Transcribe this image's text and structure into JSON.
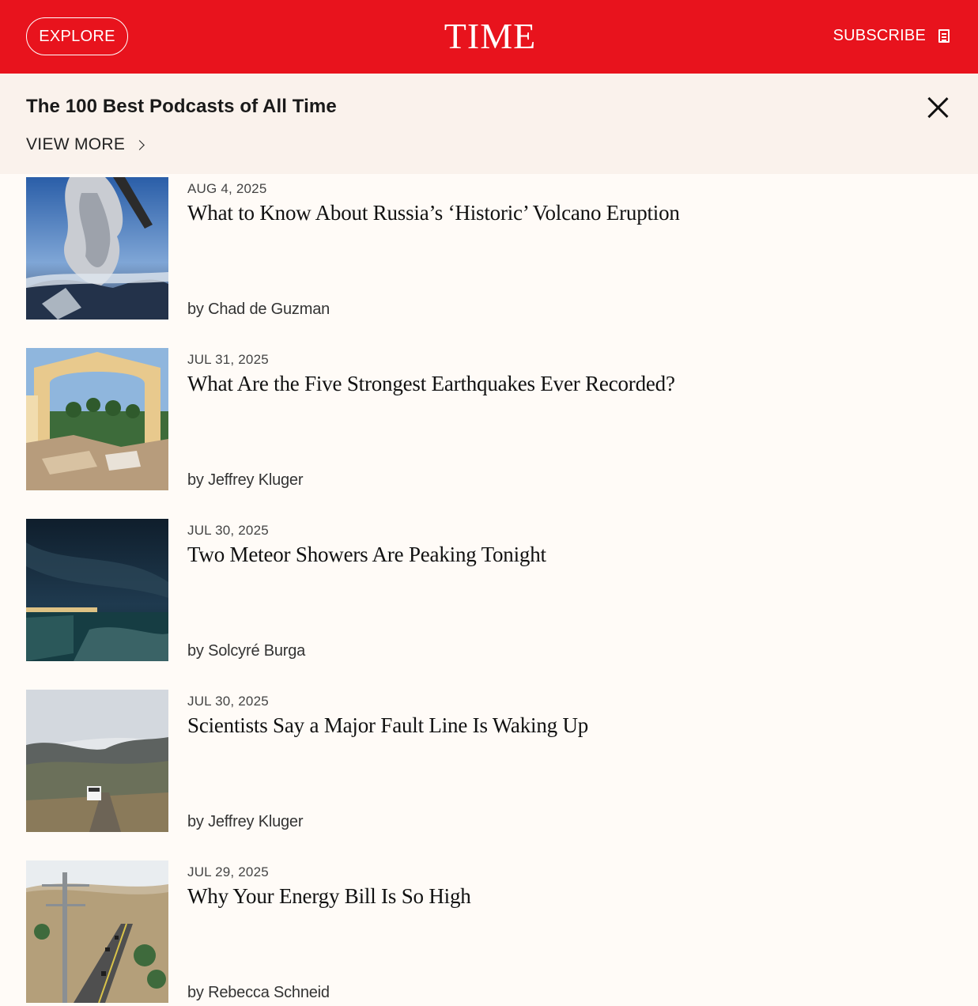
{
  "header": {
    "explore_label": "EXPLORE",
    "logo_text": "TIME",
    "subscribe_label": "SUBSCRIBE"
  },
  "banner": {
    "title": "The 100 Best Podcasts of All Time",
    "view_more_label": "VIEW MORE"
  },
  "articles": [
    {
      "date": "AUG 4, 2025",
      "title": "What to Know About Russia’s ‘Historic’ Volcano Eruption",
      "byline": "by Chad de Guzman"
    },
    {
      "date": "JUL 31, 2025",
      "title": "What Are the Five Strongest Earthquakes Ever Recorded?",
      "byline": "by Jeffrey Kluger"
    },
    {
      "date": "JUL 30, 2025",
      "title": "Two Meteor Showers Are Peaking Tonight",
      "byline": "by Solcyré Burga"
    },
    {
      "date": "JUL 30, 2025",
      "title": "Scientists Say a Major Fault Line Is Waking Up",
      "byline": "by Jeffrey Kluger"
    },
    {
      "date": "JUL 29, 2025",
      "title": "Why Your Energy Bill Is So High",
      "byline": "by Rebecca Schneid"
    }
  ],
  "colors": {
    "brand_red": "#e8131d",
    "banner_bg": "#faf2ec",
    "page_bg": "#fffbf7"
  }
}
